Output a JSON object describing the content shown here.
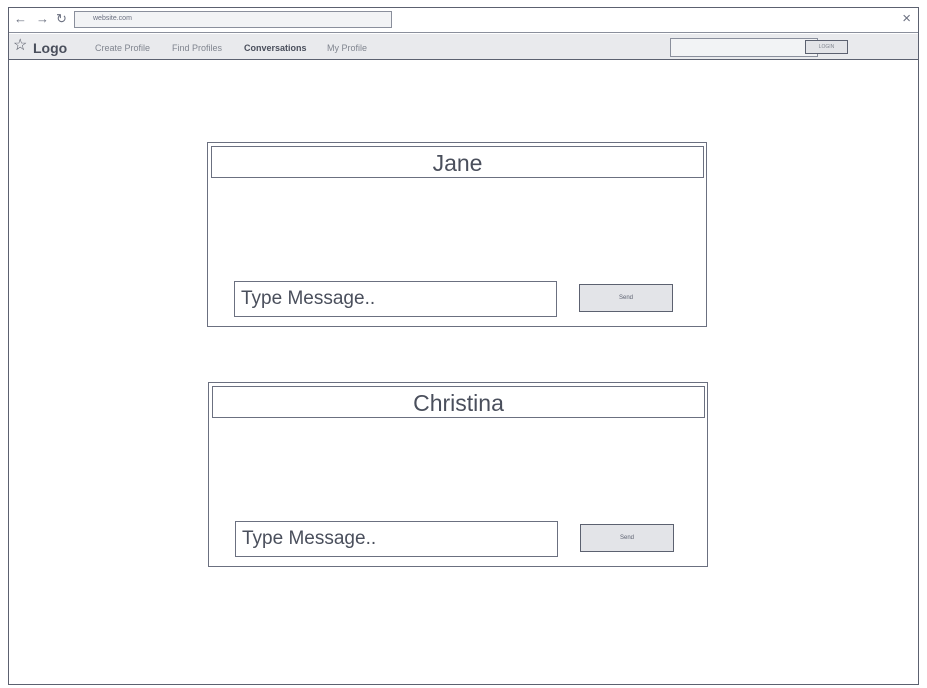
{
  "browser": {
    "url": "website.com",
    "back_icon": "←",
    "forward_icon": "→",
    "reload_icon": "↻",
    "close_icon": "×"
  },
  "nav": {
    "logo_icon": "☆",
    "logo": "Logo",
    "links": [
      {
        "label": "Create Profile"
      },
      {
        "label": "Find Profiles"
      },
      {
        "label": "Conversations"
      },
      {
        "label": "My Profile"
      }
    ],
    "active_link": "Conversations",
    "login_label": "LOGIN"
  },
  "conversations": [
    {
      "name": "Jane",
      "input_placeholder": "Type Message..",
      "send_label": "Send"
    },
    {
      "name": "Christina",
      "input_placeholder": "Type Message..",
      "send_label": "Send"
    }
  ],
  "colors": {
    "border": "#5c6170",
    "text": "#4a4f5c",
    "menubar_bg": "#e9eaed",
    "button_bg": "#e3e4e8"
  }
}
